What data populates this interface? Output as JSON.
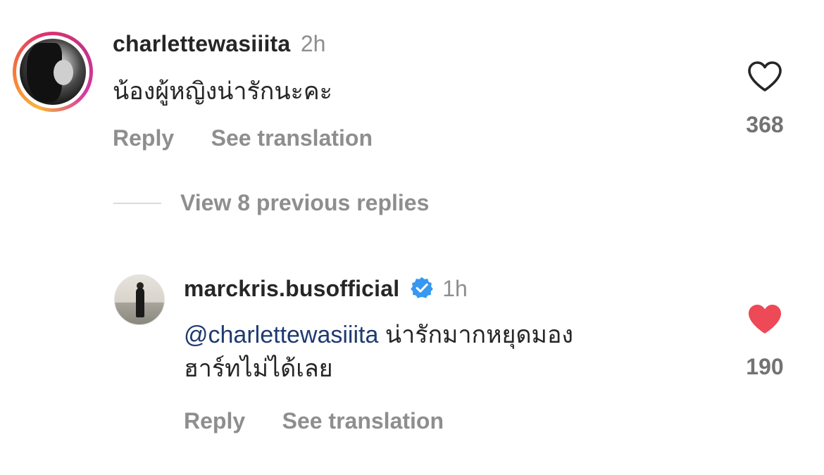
{
  "comments": [
    {
      "username": "charlettewasiiita",
      "time": "2h",
      "text": "น้องผู้หญิงน่ารักนะคะ",
      "reply_label": "Reply",
      "translate_label": "See translation",
      "likes": "368",
      "liked": false
    }
  ],
  "view_replies_label": "View 8 previous replies",
  "reply": {
    "username": "marckris.busofficial",
    "verified": true,
    "time": "1h",
    "mention": "@charlettewasiiita",
    "text_line1": "น่ารักมากหยุดมอง",
    "text_line2": "ฮาร์ทไม่ได้เลย",
    "reply_label": "Reply",
    "translate_label": "See translation",
    "likes": "190",
    "liked": true
  },
  "colors": {
    "liked_heart": "#ed4956",
    "verified_badge": "#3897f0",
    "mention": "#1e3a70"
  },
  "icons": {
    "like_outline": "heart-outline-icon",
    "like_filled": "heart-filled-icon",
    "verified": "verified-badge-icon"
  }
}
